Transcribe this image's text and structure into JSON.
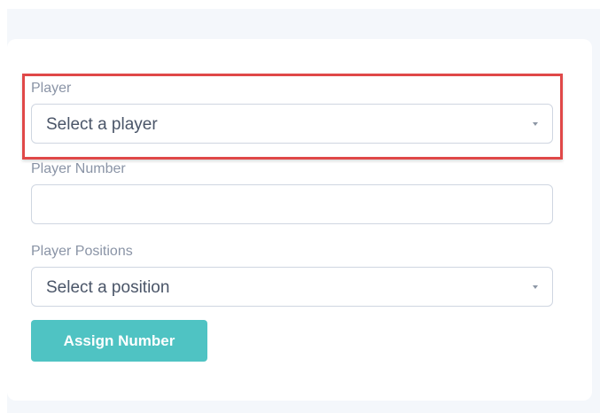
{
  "form": {
    "player": {
      "label": "Player",
      "value": "Select a player"
    },
    "player_number": {
      "label": "Player Number",
      "value": "",
      "placeholder": ""
    },
    "player_positions": {
      "label": "Player Positions",
      "value": "Select a position"
    },
    "assign_button_label": "Assign Number"
  },
  "icons": {
    "dropdown": "chevron-down-icon"
  },
  "colors": {
    "highlight_border": "#e04848",
    "button_background": "#4fc3c3",
    "button_text": "#ffffff",
    "label_text": "#8a94a6"
  }
}
